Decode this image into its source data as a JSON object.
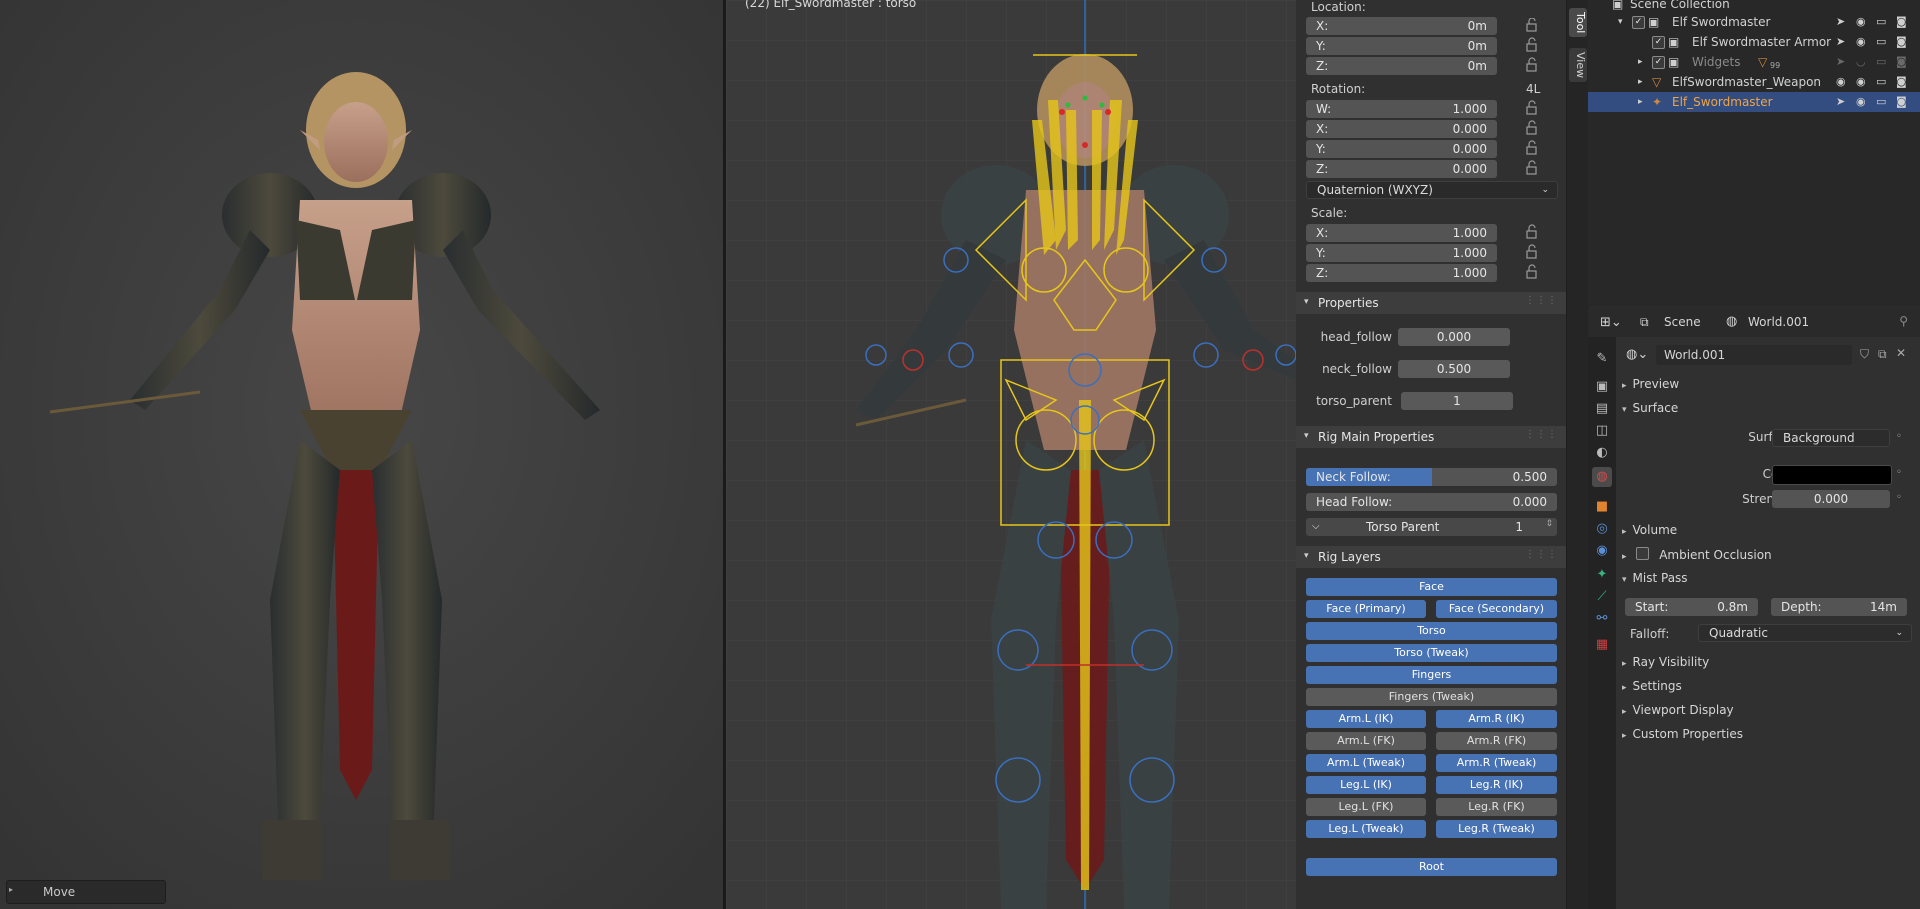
{
  "render_view": {
    "operator_panel": "Move"
  },
  "pose_view": {
    "title": "(22) Elf_Swordmaster : torso"
  },
  "npanel": {
    "tabs": [
      "Tool",
      "View"
    ],
    "location": {
      "label": "Location:",
      "x": {
        "k": "X:",
        "v": "0m"
      },
      "y": {
        "k": "Y:",
        "v": "0m"
      },
      "z": {
        "k": "Z:",
        "v": "0m"
      }
    },
    "rotation": {
      "label": "Rotation:",
      "mode_badge": "4L",
      "w": {
        "k": "W:",
        "v": "1.000"
      },
      "x": {
        "k": "X:",
        "v": "0.000"
      },
      "y": {
        "k": "Y:",
        "v": "0.000"
      },
      "z": {
        "k": "Z:",
        "v": "0.000"
      },
      "mode": "Quaternion (WXYZ)"
    },
    "scale": {
      "label": "Scale:",
      "x": {
        "k": "X:",
        "v": "1.000"
      },
      "y": {
        "k": "Y:",
        "v": "1.000"
      },
      "z": {
        "k": "Z:",
        "v": "1.000"
      }
    },
    "properties": {
      "title": "Properties",
      "items": [
        {
          "label": "head_follow",
          "value": "0.000"
        },
        {
          "label": "neck_follow",
          "value": "0.500"
        },
        {
          "label": "torso_parent",
          "value": "1"
        }
      ]
    },
    "rig_main": {
      "title": "Rig Main Properties",
      "neck_follow": {
        "label": "Neck Follow:",
        "value": "0.500",
        "fraction": 0.5
      },
      "head_follow": {
        "label": "Head Follow:",
        "value": "0.000",
        "fraction": 0.0
      },
      "torso_parent": {
        "label": "Torso Parent",
        "value": "1"
      }
    },
    "rig_layers": {
      "title": "Rig Layers",
      "face": "Face",
      "face_primary": "Face (Primary)",
      "face_secondary": "Face (Secondary)",
      "torso": "Torso",
      "torso_tweak": "Torso (Tweak)",
      "fingers": "Fingers",
      "fingers_tweak": "Fingers (Tweak)",
      "arm_l_ik": "Arm.L (IK)",
      "arm_r_ik": "Arm.R (IK)",
      "arm_l_fk": "Arm.L (FK)",
      "arm_r_fk": "Arm.R (FK)",
      "arm_l_tweak": "Arm.L (Tweak)",
      "arm_r_tweak": "Arm.R (Tweak)",
      "leg_l_ik": "Leg.L (IK)",
      "leg_r_ik": "Leg.R (IK)",
      "leg_l_fk": "Leg.L (FK)",
      "leg_r_fk": "Leg.R (FK)",
      "leg_l_tweak": "Leg.L (Tweak)",
      "leg_r_tweak": "Leg.R (Tweak)",
      "root": "Root"
    }
  },
  "outliner": {
    "collection": "Scene Collection",
    "items": [
      {
        "name": "Elf Swordmaster"
      },
      {
        "name": "Elf Swordmaster Armor"
      },
      {
        "name": "Widgets"
      },
      {
        "name": "ElfSwordmaster_Weapon"
      },
      {
        "name": "Elf_Swordmaster"
      }
    ],
    "widgets_badge": "99"
  },
  "properties_editor": {
    "scene": "Scene",
    "world": "World.001",
    "world_field": "World.001",
    "sections": {
      "preview": "Preview",
      "surface": "Surface",
      "volume": "Volume",
      "ambient_occlusion": "Ambient Occlusion",
      "mist_pass": "Mist Pass",
      "ray_visibility": "Ray Visibility",
      "settings": "Settings",
      "viewport_display": "Viewport Display",
      "custom_properties": "Custom Properties"
    },
    "surface": {
      "surface_label": "Surface",
      "surface_value": "Background",
      "color_label": "Color",
      "color_value": "#000000",
      "strength_label": "Strength",
      "strength_value": "0.000"
    },
    "mist": {
      "start_label": "Start:",
      "start_value": "0.8m",
      "depth_label": "Depth:",
      "depth_value": "14m",
      "falloff_label": "Falloff:",
      "falloff_value": "Quadratic"
    }
  },
  "colors": {
    "accent": "#4772b3",
    "selection": "#334d80",
    "bone": "#e6c619",
    "bone_blue": "#3a6fc0",
    "bone_red": "#c0302a"
  }
}
